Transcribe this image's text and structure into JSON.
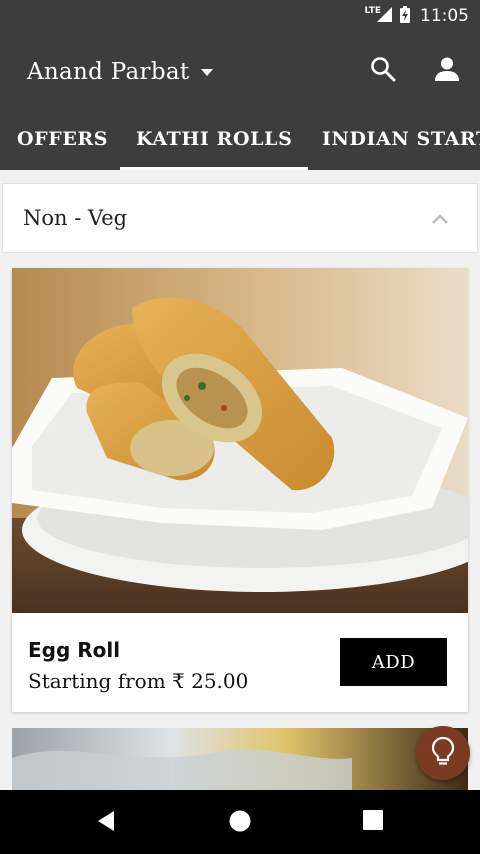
{
  "status_bar": {
    "network": "LTE",
    "time": "11:05",
    "icons": [
      "lte-signal-icon",
      "battery-charging-icon"
    ]
  },
  "app_bar": {
    "title": "Anand Parbat",
    "icons": [
      "dropdown-caret-icon",
      "search-icon",
      "account-icon"
    ]
  },
  "tabs": [
    {
      "label": "OFFERS"
    },
    {
      "label": "KATHI ROLLS",
      "active": true
    },
    {
      "label": "INDIAN STARTERS"
    }
  ],
  "section": {
    "title": "Non - Veg",
    "icon": "chevron-up-icon"
  },
  "items": [
    {
      "name": "Egg Roll",
      "price": "Starting from ₹ 25.00",
      "add_label": "ADD"
    }
  ],
  "fab": {
    "icon": "lightbulb-icon",
    "color": "#7a3a24"
  },
  "navigation": {
    "icons": [
      "back-icon",
      "home-icon",
      "recents-icon"
    ]
  },
  "colors": {
    "toolbar": "#3d3d3d",
    "button": "#000000",
    "background": "#f1f1f1"
  }
}
